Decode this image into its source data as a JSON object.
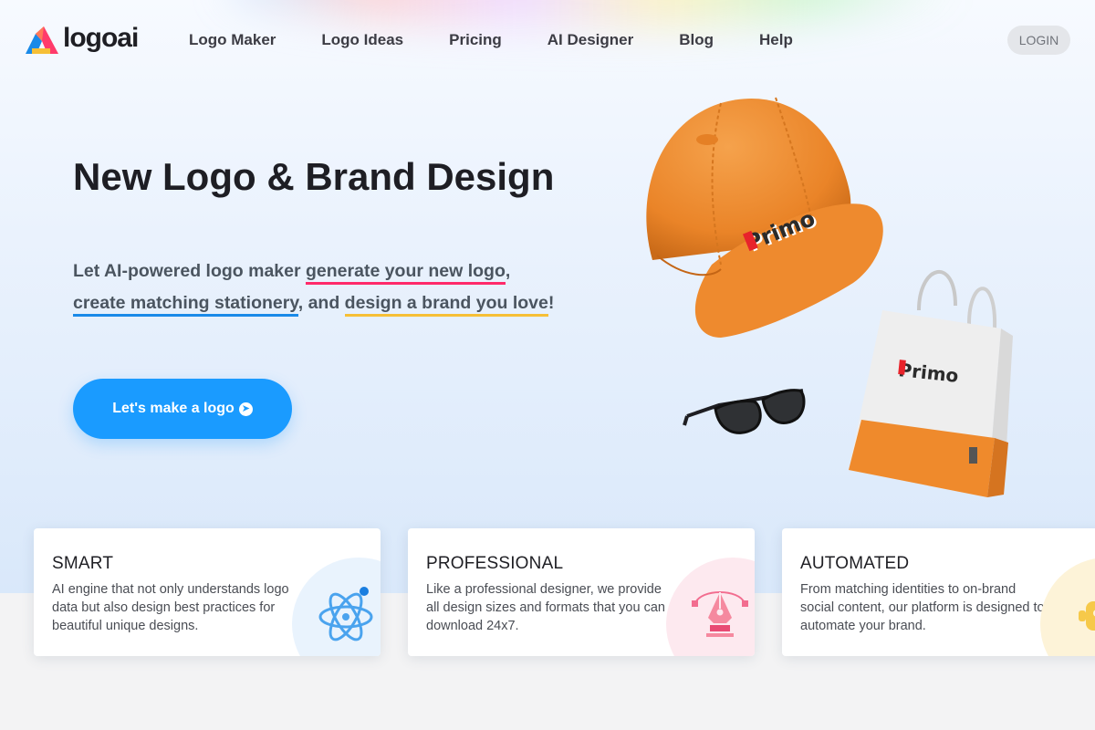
{
  "brand": {
    "name": "logoai"
  },
  "nav": {
    "items": [
      "Logo Maker",
      "Logo Ideas",
      "Pricing",
      "AI Designer",
      "Blog",
      "Help"
    ],
    "login": "LOGIN"
  },
  "hero": {
    "title": "New Logo & Brand Design",
    "subtitle": {
      "part1": "Let AI-powered logo maker ",
      "link1": "generate your new logo",
      "sep1": ",",
      "link2": "create matching stationery",
      "sep2": ", and ",
      "link3": "design a brand you love",
      "end": "!"
    },
    "cta": "Let's make a logo"
  },
  "products": {
    "brand_print": "Primo"
  },
  "cards": [
    {
      "title": "SMART",
      "description": "AI engine that not only understands logo data but also design best practices for beautiful unique designs.",
      "icon": "atom-icon",
      "color": "#e9f3fd"
    },
    {
      "title": "PROFESSIONAL",
      "description": "Like a professional designer, we provide all design sizes and formats that you can download 24x7.",
      "icon": "pen-tool-icon",
      "color": "#fde9ef"
    },
    {
      "title": "AUTOMATED",
      "description": "From matching identities to on-brand social content, our platform is designed to automate your brand.",
      "icon": "robot-icon",
      "color": "#fdf3d8"
    }
  ],
  "colors": {
    "accent": "#1a9bff",
    "underline_red": "#ff2a6a",
    "underline_blue": "#1a8ae8",
    "underline_yellow": "#f6bf36",
    "cap_orange": "#f08a2a"
  }
}
